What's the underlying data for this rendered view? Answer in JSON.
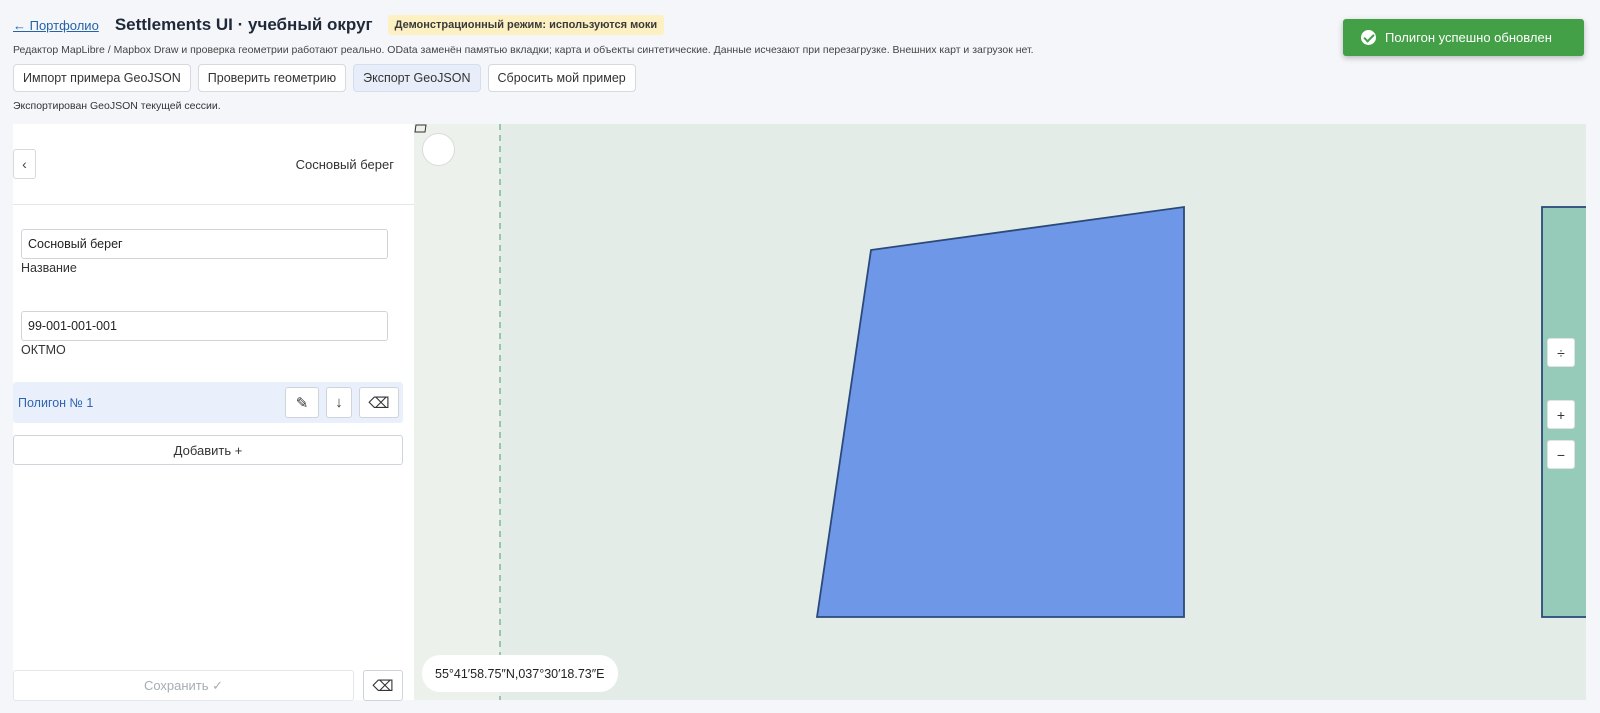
{
  "header": {
    "back_link": "← Портфолио",
    "title": "Settlements UI · учебный округ",
    "demo_badge": "Демонстрационный режим: используются моки",
    "subtitle": "Редактор MapLibre / Mapbox Draw и проверка геометрии работают реально. OData заменён памятью вкладки; карта и объекты синтетические. Данные исчезают при перезагрузке. Внешних карт и загрузок нет.",
    "status": "Экспортирован GeoJSON текущей сессии."
  },
  "toolbar": {
    "buttons": [
      {
        "label": "Импорт примера GeoJSON",
        "active": false
      },
      {
        "label": "Проверить геометрию",
        "active": false
      },
      {
        "label": "Экспорт GeoJSON",
        "active": true
      },
      {
        "label": "Сбросить мой пример",
        "active": false
      }
    ]
  },
  "toast": {
    "message": "Полигон успешно обновлен",
    "color": "#43a047"
  },
  "sidebar": {
    "back_icon": "chevron-left-icon",
    "back_glyph": "‹",
    "title": "Сосновый берег",
    "name_value": "Сосновый берег",
    "name_label": "Название",
    "oktmo_value": "99-001-001-001",
    "oktmo_label": "ОКТМО",
    "polygon": {
      "name": "Полигон № 1",
      "edit_glyph": "✎",
      "down_glyph": "↓",
      "delete_glyph": "⌫"
    },
    "add_label": "Добавить +",
    "save_label": "Сохранить ✓",
    "delete_glyph": "⌫"
  },
  "map": {
    "polygon_fill": "#6f97e8",
    "polygon_stroke": "#2b4a7a",
    "side_polygon_fill": "#97cbb9",
    "coordinates": "55°41′58.75″N,037°30′18.73″E",
    "controls": {
      "compass_glyph": "÷",
      "zoom_in_glyph": "+",
      "zoom_out_glyph": "−"
    }
  }
}
